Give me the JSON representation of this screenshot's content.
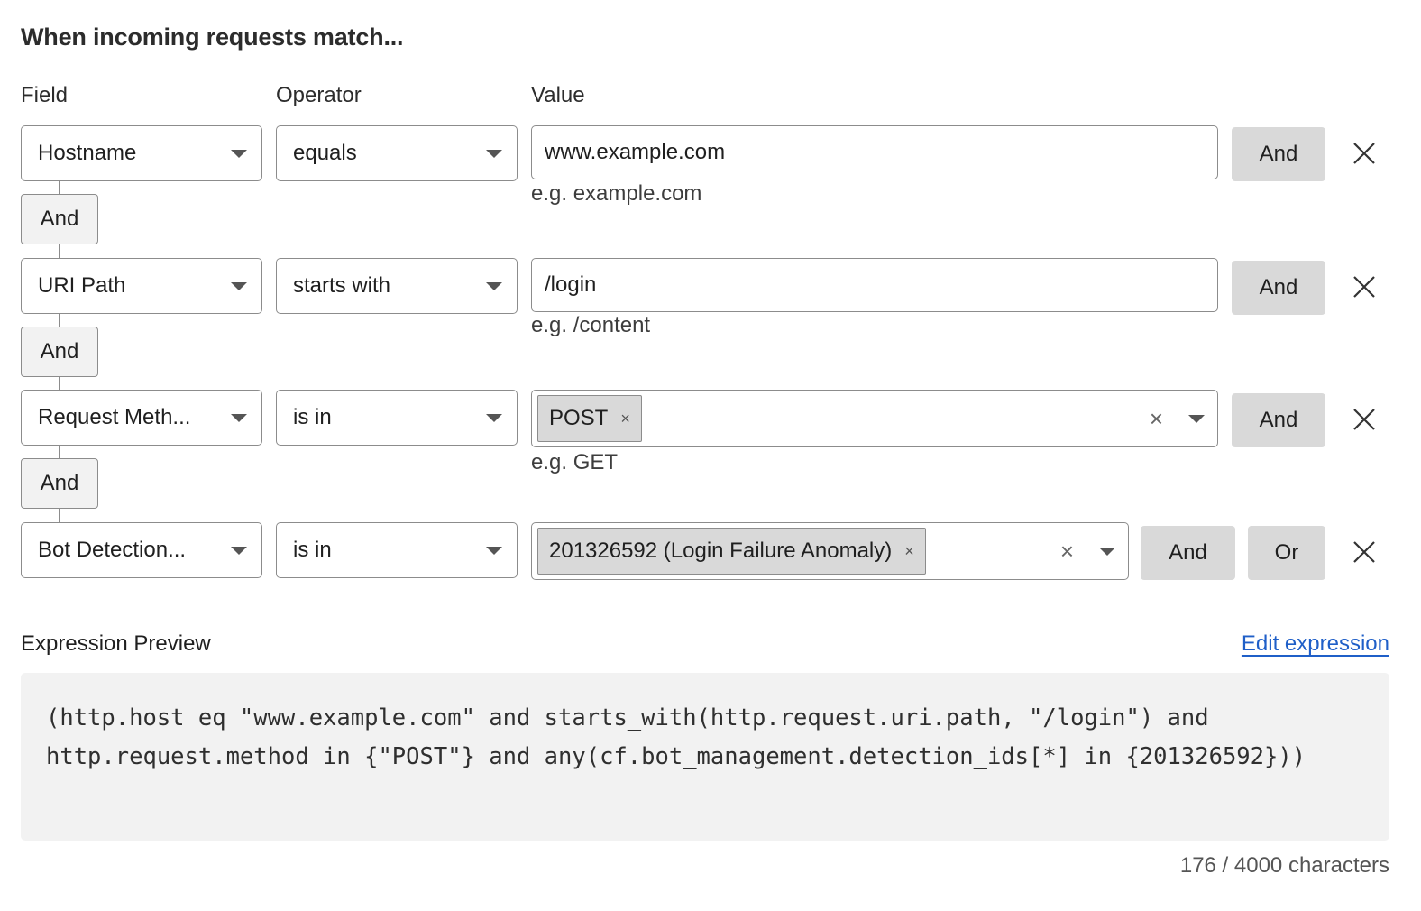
{
  "heading": "When incoming requests match...",
  "columns": {
    "field": "Field",
    "operator": "Operator",
    "value": "Value"
  },
  "rows": [
    {
      "field": "Hostname",
      "operator": "equals",
      "value": "www.example.com",
      "hint": "e.g. example.com",
      "and_label": "And"
    },
    {
      "field": "URI Path",
      "operator": "starts with",
      "value": "/login",
      "hint": "e.g. /content",
      "and_label": "And"
    },
    {
      "field": "Request Meth...",
      "operator": "is in",
      "chip": "POST",
      "hint": "e.g. GET",
      "and_label": "And"
    },
    {
      "field": "Bot Detection...",
      "operator": "is in",
      "chip": "201326592 (Login Failure Anomaly)",
      "and_label": "And",
      "or_label": "Or"
    }
  ],
  "connector_label": "And",
  "icons": {
    "remove": "close-icon",
    "chip_remove": "small-x-icon",
    "clear": "clear-icon",
    "dropdown": "chevron-down-icon"
  },
  "preview": {
    "label": "Expression Preview",
    "edit_link": "Edit expression",
    "expression": "(http.host eq \"www.example.com\" and starts_with(http.request.uri.path, \"/login\") and http.request.method in {\"POST\"} and any(cf.bot_management.detection_ids[*] in {201326592}))",
    "counter": "176 / 4000 characters"
  },
  "colors": {
    "link": "#1f5fc8",
    "button_bg": "#d9d9d9",
    "code_bg": "#f2f2f2",
    "border": "#8c8c8c"
  }
}
